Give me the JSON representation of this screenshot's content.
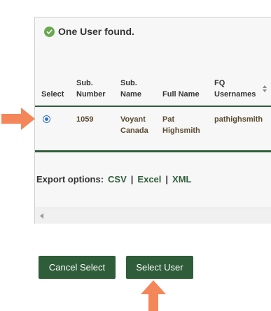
{
  "status": {
    "message": "One User found.",
    "icon": "check-circle-icon",
    "icon_color": "#6aa84f"
  },
  "table": {
    "columns": [
      {
        "label": "Select"
      },
      {
        "label": "Sub.\nNumber"
      },
      {
        "label": "Sub.\nName"
      },
      {
        "label": "Full Name"
      },
      {
        "label": "FQ\nUsernames"
      }
    ],
    "rows": [
      {
        "selected": true,
        "sub_number": "1059",
        "sub_name": "Voyant\nCanada",
        "full_name": "Pat\nHighsmith",
        "fq_username": "pathighsmith"
      }
    ]
  },
  "export": {
    "label": "Export options:",
    "csv": "CSV",
    "excel": "Excel",
    "xml": "XML",
    "separator": "|"
  },
  "buttons": {
    "cancel": "Cancel Select",
    "select": "Select User",
    "color": "#2f5d3a"
  },
  "annotations": {
    "arrow_color": "#f4875a",
    "left_arrow_icon": "pointer-arrow-right-icon",
    "up_arrow_icon": "pointer-arrow-up-icon"
  }
}
